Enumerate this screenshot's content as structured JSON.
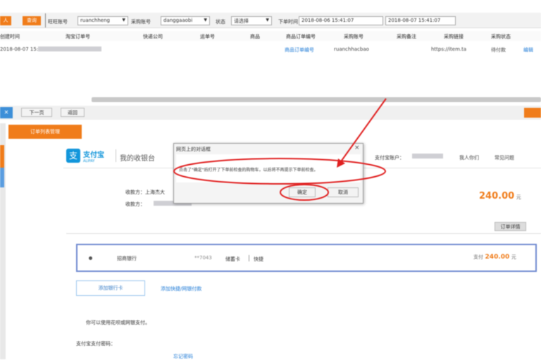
{
  "toolbar": {
    "left_btn_label": "人",
    "query_btn_label": "查询",
    "field_account_label": "旺旺账号",
    "field_account_value": "ruanchheng",
    "field_operator_label": "采购账号",
    "field_operator_value": "danggaaobi",
    "field_status_label": "状态",
    "field_status_value": "请选择",
    "field_time_label": "下单时间",
    "time_from": "2018-08-06 15:41:07",
    "time_to": "2018-08-07 15:41:07"
  },
  "table": {
    "headers": [
      "创建时间",
      "淘宝订单号",
      "快递公司",
      "运单号",
      "商品",
      "商品订单编号",
      "采购账号",
      "采购备注",
      "采购链接",
      "采购状态"
    ],
    "row": {
      "date": "2018-08-07 15:",
      "pay_link": "商品订单编号",
      "account": "ruanchhacbao",
      "url": "https://item.ta",
      "status": "待付款",
      "action": "编辑"
    }
  },
  "nav": {
    "next_label": "下一页",
    "back_label": "返回"
  },
  "left_panel": {
    "tab_label": "订单列表管理"
  },
  "alipay": {
    "logo_text": "支付宝",
    "logo_sub": "ALIPAY",
    "header_title": "我的收银台",
    "account_label": "支付宝账户：",
    "login_link": "我人你们",
    "help_link": "常见问题",
    "order_line1": "收款方：上海杰大",
    "order_line2": "收款方：",
    "amount": "240.00",
    "amount_unit": "元",
    "order_detail_btn": "订单详情",
    "payment": {
      "radio_label": "○",
      "bank_name": "招商银行",
      "card_tail": "**7043",
      "card_type": "储蓄卡",
      "quick_pay": "快捷",
      "pay_label": "支付",
      "pay_amount": "240.00",
      "pay_unit": "元"
    },
    "other_method_btn": "添加银行卡",
    "other_method_btn2": "添加快捷/网银付款",
    "tip_line": "你可以使用花呗或网银支付。",
    "balance_label": "支付宝支付密码：",
    "forgot_link": "忘记密码"
  },
  "dialog": {
    "title": "网页上的对话框",
    "close": "×",
    "message": "点击了\"确定\"后打开了下单前检查的购物车，以后将不再提示下单前检查。",
    "ok_label": "确定",
    "cancel_label": "取消"
  },
  "colors": {
    "accent_orange": "#f07c1a",
    "annotation_red": "#e02020",
    "alipay_blue": "#1296db",
    "card_border": "#6f8ad0"
  }
}
